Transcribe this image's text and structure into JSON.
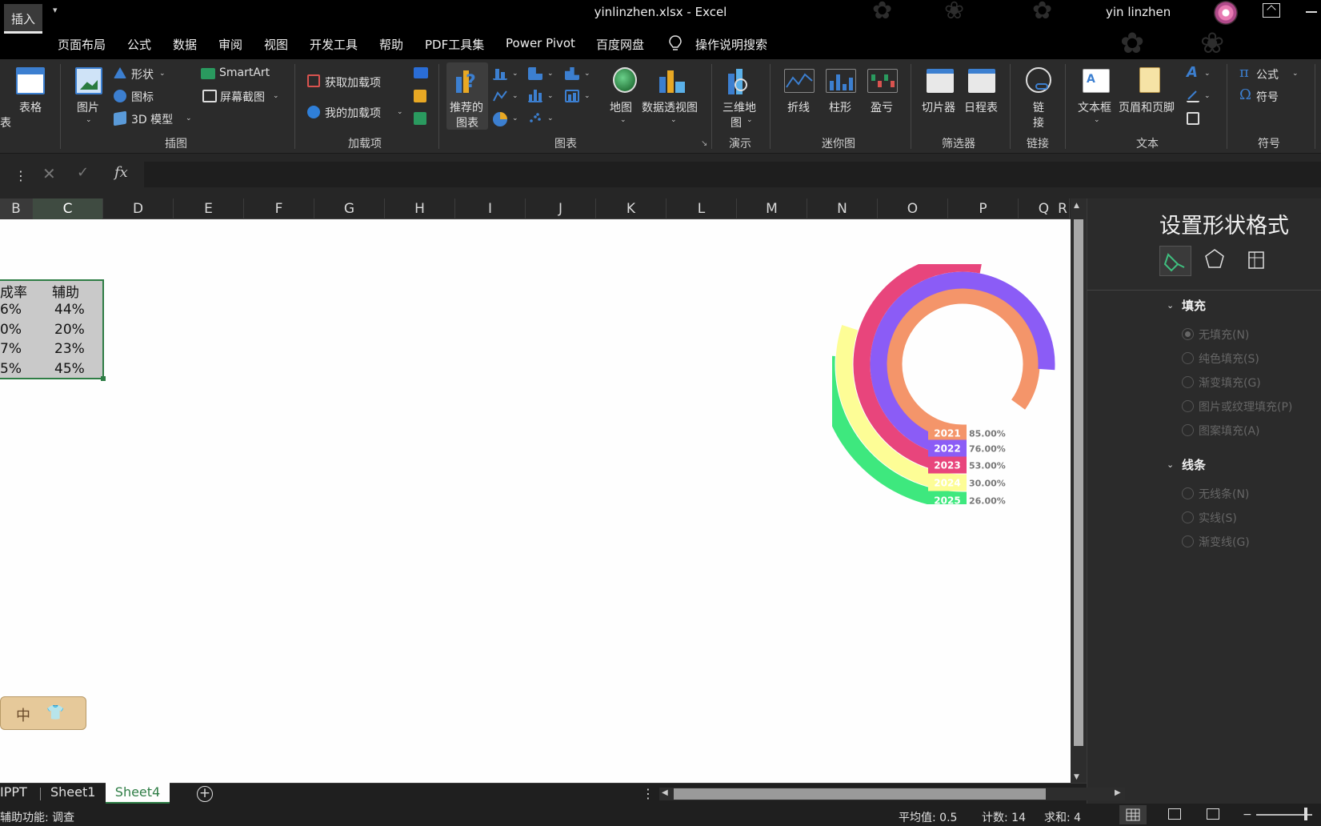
{
  "window": {
    "title": "yinlinzhen.xlsx  -  Excel",
    "user": "yin linzhen"
  },
  "menu_tabs": [
    "插入",
    "页面布局",
    "公式",
    "数据",
    "审阅",
    "视图",
    "开发工具",
    "帮助",
    "PDF工具集",
    "Power Pivot",
    "百度网盘",
    "操作说明搜索"
  ],
  "ribbon": {
    "table_frag": "表",
    "table": "表格",
    "pictures": "图片",
    "shapes": "形状",
    "icons": "图标",
    "model3d": "3D 模型",
    "smartart": "SmartArt",
    "screenshot": "屏幕截图",
    "get_addins": "获取加载项",
    "my_addins": "我的加载项",
    "recommended_charts_1": "推荐的",
    "recommended_charts_2": "图表",
    "maps": "地图",
    "pivot_chart": "数据透视图",
    "map3d_1": "三维地",
    "map3d_2": "图",
    "spark_line": "折线",
    "spark_column": "柱形",
    "spark_winloss": "盈亏",
    "slicer": "切片器",
    "timeline": "日程表",
    "link_1": "链",
    "link_2": "接",
    "textbox": "文本框",
    "header_footer": "页眉和页脚",
    "equation": "公式",
    "symbol": "符号",
    "groups": {
      "illustrations": "插图",
      "addins": "加载项",
      "charts": "图表",
      "tours": "演示",
      "sparklines": "迷你图",
      "filters": "筛选器",
      "links": "链接",
      "text": "文本",
      "symbols": "符号"
    }
  },
  "columns": [
    "B",
    "C",
    "D",
    "E",
    "F",
    "G",
    "H",
    "I",
    "J",
    "K",
    "L",
    "M",
    "N",
    "O",
    "P",
    "Q",
    "R"
  ],
  "table": {
    "header_b": "成率",
    "header_c": "辅助",
    "rows": [
      {
        "b": "6%",
        "c": "44%"
      },
      {
        "b": "0%",
        "c": "20%"
      },
      {
        "b": "7%",
        "c": "23%"
      },
      {
        "b": "5%",
        "c": "45%"
      }
    ]
  },
  "chart_data": {
    "type": "pie",
    "subtype": "radial-bar",
    "categories": [
      "2021",
      "2022",
      "2023",
      "2024",
      "2025"
    ],
    "values": [
      0.85,
      0.76,
      0.53,
      0.3,
      0.26
    ],
    "value_labels": [
      "85.00%",
      "76.00%",
      "53.00%",
      "30.00%",
      "26.00%"
    ],
    "colors": [
      "#f4956a",
      "#8b5cf6",
      "#e8457c",
      "#fdfd96",
      "#3ee87e"
    ]
  },
  "pane": {
    "title": "设置形状格式",
    "fill_head": "填充",
    "fill_options": [
      "无填充(N)",
      "纯色填充(S)",
      "渐变填充(G)",
      "图片或纹理填充(P)",
      "图案填充(A)"
    ],
    "line_head": "线条",
    "line_options": [
      "无线条(N)",
      "实线(S)",
      "渐变线(G)"
    ]
  },
  "sheets": [
    "IPPT",
    "Sheet1",
    "Sheet4"
  ],
  "status": {
    "left": "辅助功能: 调查",
    "average": "平均值: 0.5",
    "count": "计数: 14",
    "sum": "求和: 4"
  },
  "ime": "中"
}
